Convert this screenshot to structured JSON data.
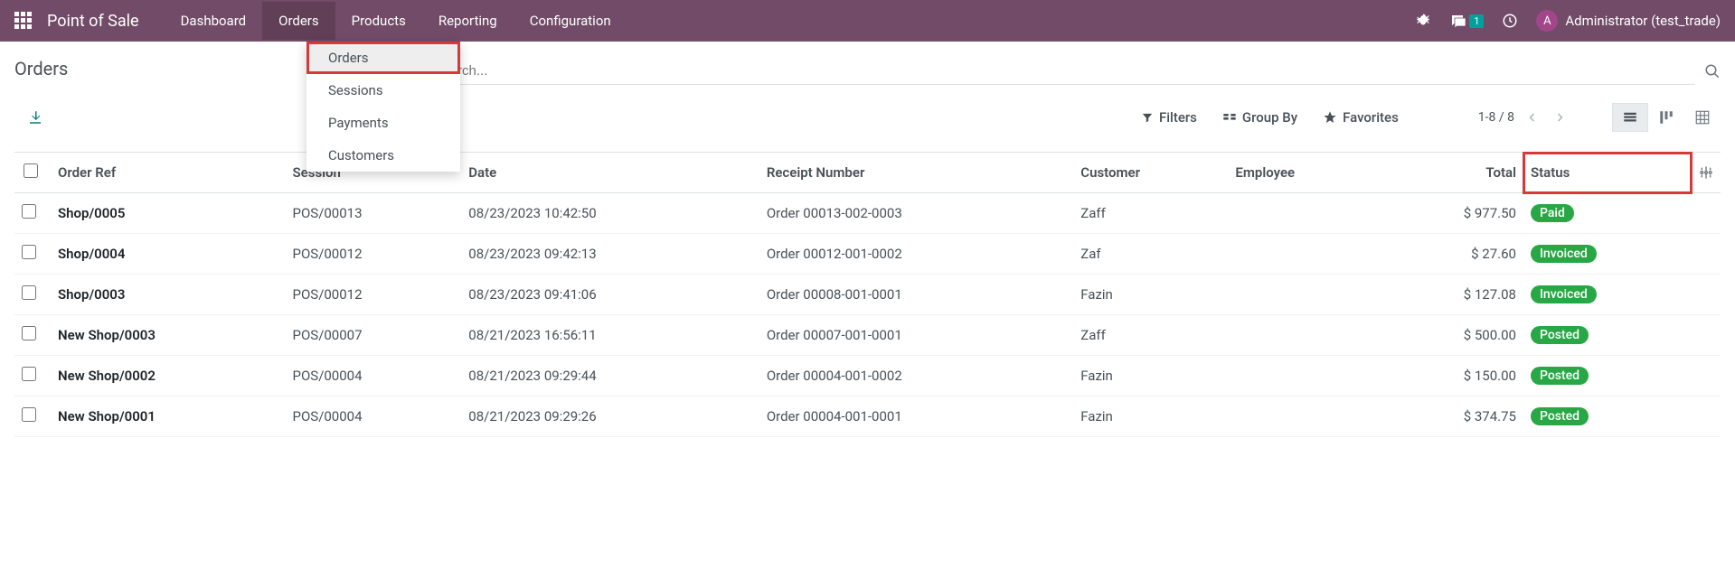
{
  "topbar": {
    "app_name": "Point of Sale",
    "nav": [
      "Dashboard",
      "Orders",
      "Products",
      "Reporting",
      "Configuration"
    ],
    "active_nav_index": 1,
    "chat_badge": "1",
    "user_initial": "A",
    "user_name": "Administrator (test_trade)"
  },
  "dropdown": {
    "items": [
      "Orders",
      "Sessions",
      "Payments",
      "Customers"
    ],
    "highlighted_index": 0
  },
  "page": {
    "title": "Orders",
    "search_placeholder": "Search...",
    "filters_label": "Filters",
    "groupby_label": "Group By",
    "favorites_label": "Favorites",
    "pager_text": "1-8 / 8"
  },
  "table": {
    "headers": {
      "order_ref": "Order Ref",
      "session": "Session",
      "date": "Date",
      "receipt": "Receipt Number",
      "customer": "Customer",
      "employee": "Employee",
      "total": "Total",
      "status": "Status"
    },
    "rows": [
      {
        "ref": "Shop/0005",
        "session": "POS/00013",
        "date": "08/23/2023 10:42:50",
        "receipt": "Order 00013-002-0003",
        "customer": "Zaff",
        "employee": "",
        "total": "$ 977.50",
        "status": "Paid"
      },
      {
        "ref": "Shop/0004",
        "session": "POS/00012",
        "date": "08/23/2023 09:42:13",
        "receipt": "Order 00012-001-0002",
        "customer": "Zaf",
        "employee": "",
        "total": "$ 27.60",
        "status": "Invoiced"
      },
      {
        "ref": "Shop/0003",
        "session": "POS/00012",
        "date": "08/23/2023 09:41:06",
        "receipt": "Order 00008-001-0001",
        "customer": "Fazin",
        "employee": "",
        "total": "$ 127.08",
        "status": "Invoiced"
      },
      {
        "ref": "New Shop/0003",
        "session": "POS/00007",
        "date": "08/21/2023 16:56:11",
        "receipt": "Order 00007-001-0001",
        "customer": "Zaff",
        "employee": "",
        "total": "$ 500.00",
        "status": "Posted"
      },
      {
        "ref": "New Shop/0002",
        "session": "POS/00004",
        "date": "08/21/2023 09:29:44",
        "receipt": "Order 00004-001-0002",
        "customer": "Fazin",
        "employee": "",
        "total": "$ 150.00",
        "status": "Posted"
      },
      {
        "ref": "New Shop/0001",
        "session": "POS/00004",
        "date": "08/21/2023 09:29:26",
        "receipt": "Order 00004-001-0001",
        "customer": "Fazin",
        "employee": "",
        "total": "$ 374.75",
        "status": "Posted"
      }
    ]
  }
}
